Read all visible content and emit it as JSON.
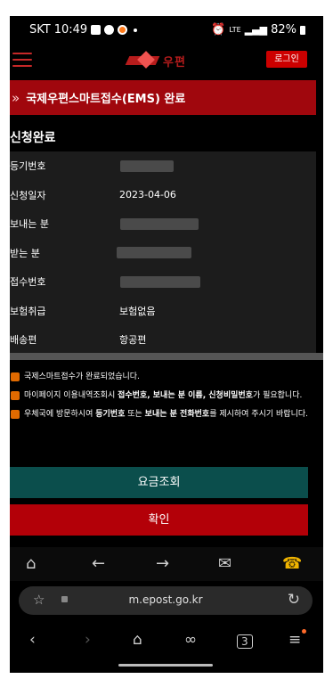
{
  "status_bar": {
    "carrier": "SKT",
    "time": "10:49",
    "network": "LTE",
    "battery": "82%"
  },
  "header": {
    "logo_text": "우편",
    "login_label": "로그인"
  },
  "page_title": "국제우편스마트접수(EMS) 완료",
  "section_title": "신청완료",
  "details": [
    {
      "label": "등기번호",
      "value": ""
    },
    {
      "label": "신청일자",
      "value": "2023-04-06"
    },
    {
      "label": "보내는 분",
      "value": ""
    },
    {
      "label": "받는 분",
      "value": ""
    },
    {
      "label": "접수번호",
      "value": ""
    },
    {
      "label": "보험취급",
      "value": "보험없음"
    },
    {
      "label": "배송편",
      "value": "항공편"
    }
  ],
  "notices": [
    {
      "text": "국제스마트접수가 완료되었습니다."
    },
    {
      "pre": "마이페이지 이용내역조회시 ",
      "bold": "접수번호, 보내는 분 이름, 신청비밀번호",
      "post": "가 필요합니다."
    },
    {
      "pre": "우체국에 방문하시여 ",
      "bold1": "등기번호",
      "mid": " 또는 ",
      "bold2": "보내는 분 전화번호",
      "post": "를 제시하여 주시기 바랍니다."
    }
  ],
  "buttons": {
    "fee_lookup": "요금조회",
    "confirm": "확인"
  },
  "browser": {
    "url": "m.epost.go.kr",
    "tab_count": "3"
  },
  "colors": {
    "title_bar": "#a0070d",
    "fee_button": "#0b4e4c",
    "confirm_button": "#b30008",
    "notice_icon": "#e06a00"
  }
}
